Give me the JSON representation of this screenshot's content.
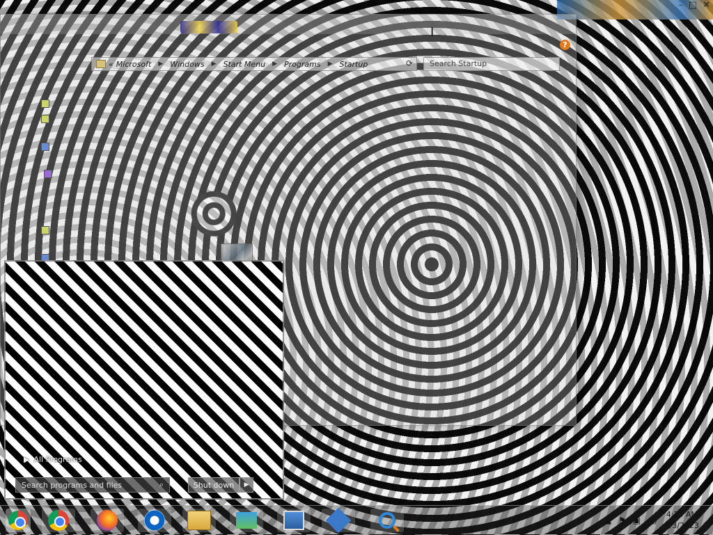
{
  "window": {
    "address": {
      "overflow": "«",
      "crumbs": [
        "Microsoft",
        "Windows",
        "Start Menu",
        "Programs",
        "Startup"
      ]
    },
    "search_placeholder": "Search Startup",
    "help_glyph": "?"
  },
  "startmenu": {
    "all_programs": "All Programs",
    "search_placeholder": "Search programs and files",
    "shutdown_label": "Shut down"
  },
  "window_controls": [
    "–",
    "□",
    "✕"
  ],
  "taskbar": {
    "pinned": [
      "chrome-icon",
      "firefox-icon",
      "edge-icon",
      "file-explorer-icon",
      "network-icon",
      "my-computer-icon",
      "settings-icon",
      "search-icon"
    ]
  },
  "clock": {
    "time": "4:13 AM",
    "date": "1/3/2023"
  }
}
